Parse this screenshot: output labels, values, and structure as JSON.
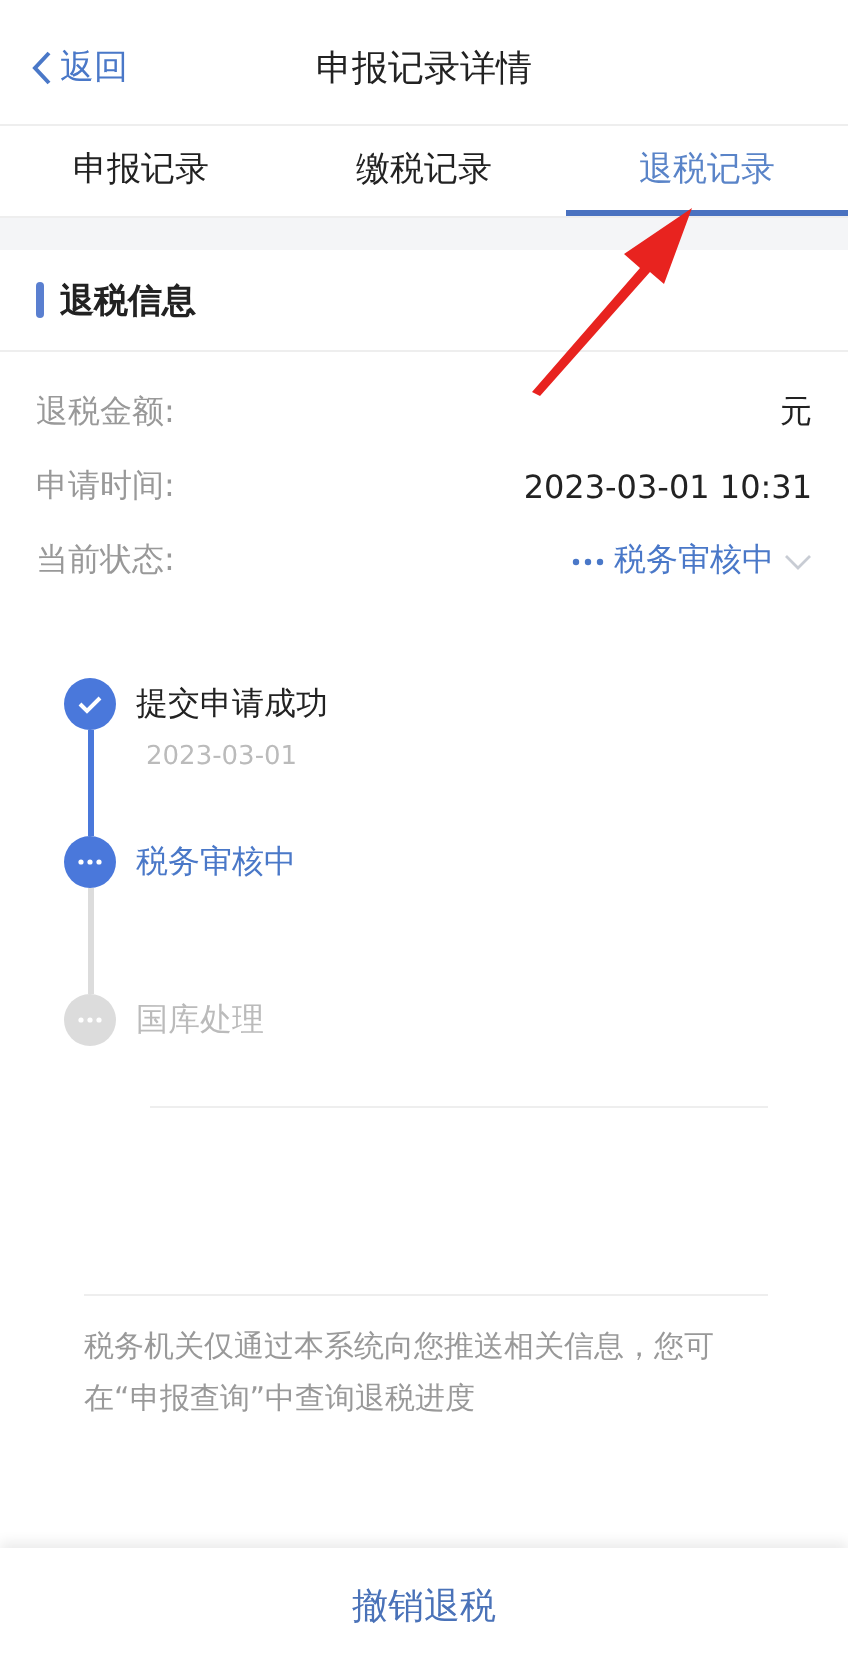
{
  "nav": {
    "back": "返回",
    "title": "申报记录详情"
  },
  "tabs": [
    {
      "label": "申报记录",
      "selected": false
    },
    {
      "label": "缴税记录",
      "selected": false
    },
    {
      "label": "退税记录",
      "selected": true
    }
  ],
  "section": {
    "title": "退税信息"
  },
  "fields": [
    {
      "label": "退税金额:",
      "value": "元",
      "kind": "plain"
    },
    {
      "label": "申请时间:",
      "value": "2023-03-01 10:31",
      "kind": "plain"
    },
    {
      "label": "当前状态:",
      "value": "税务审核中",
      "kind": "status"
    }
  ],
  "steps": [
    {
      "label": "提交申请成功",
      "date": "2023-03-01",
      "kind": "done"
    },
    {
      "label": "税务审核中",
      "kind": "active"
    },
    {
      "label": "国库处理",
      "kind": "pending"
    }
  ],
  "note": "税务机关仅通过本系统向您推送相关信息，您可在“申报查询”中查询退税进度",
  "footer_button": "撤销退税"
}
